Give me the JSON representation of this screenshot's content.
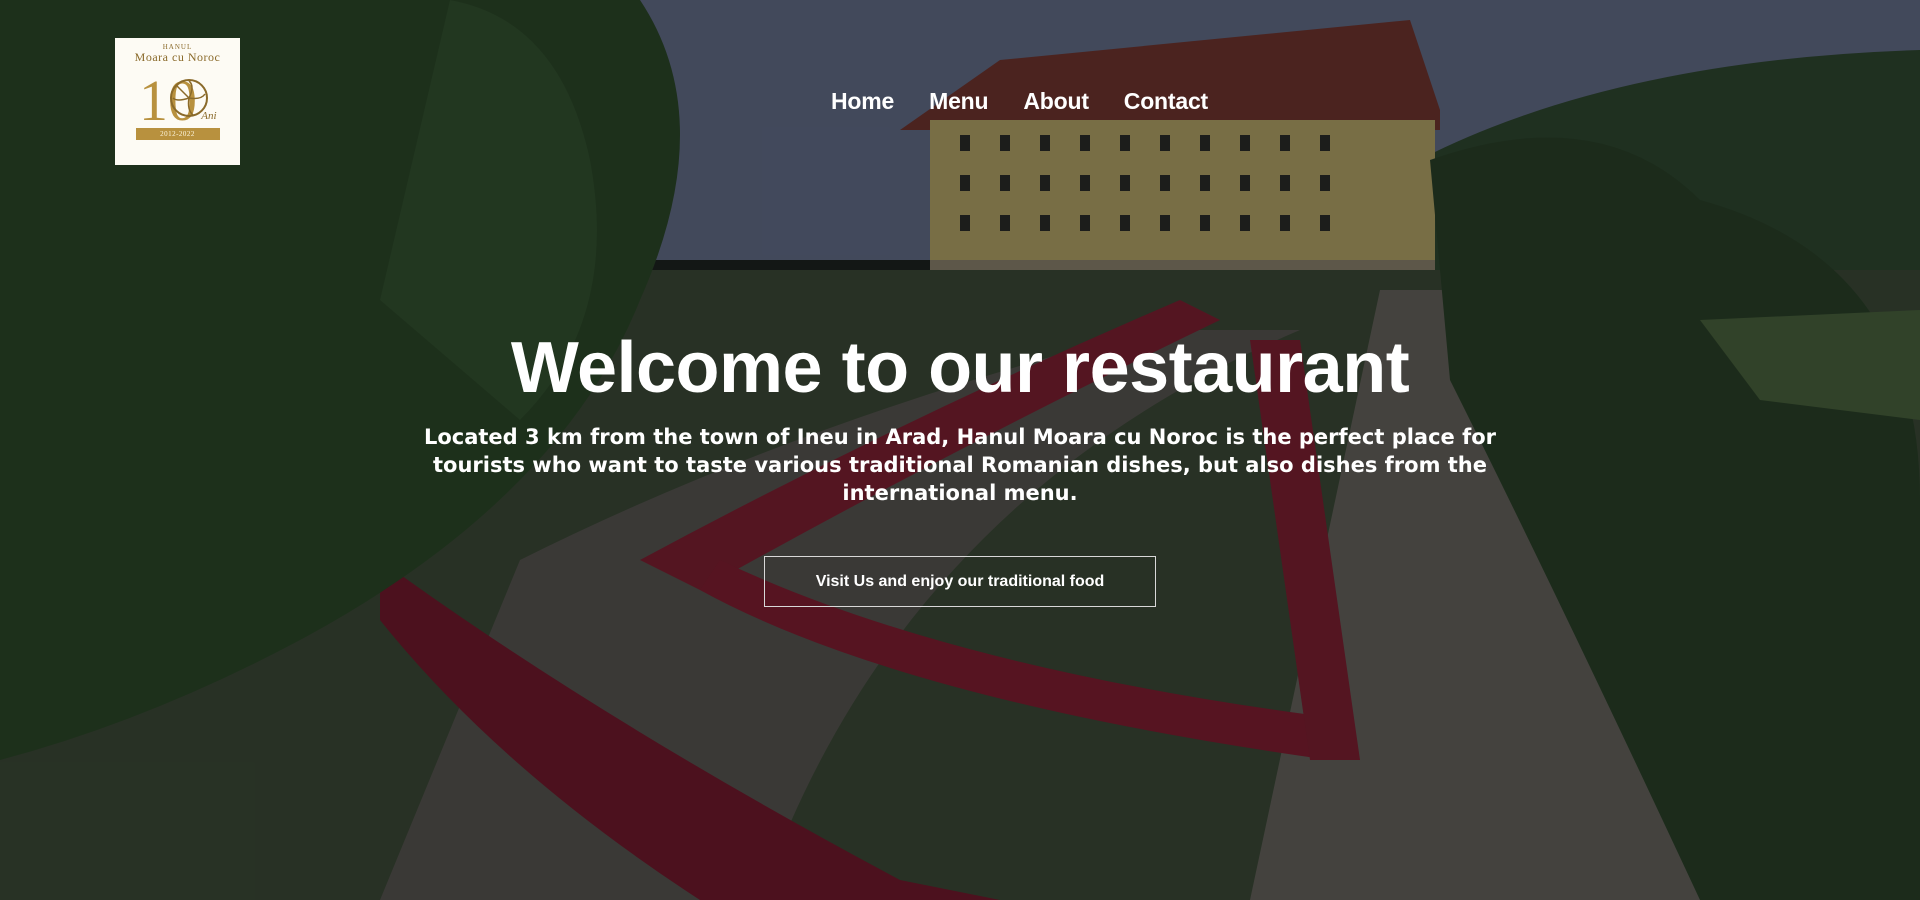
{
  "logo": {
    "top_text": "HANUL",
    "name": "Moara cu Noroc",
    "number": "10",
    "ani": "Ani",
    "years": "2012-2022"
  },
  "nav": {
    "items": [
      {
        "label": "Home"
      },
      {
        "label": "Menu"
      },
      {
        "label": "About"
      },
      {
        "label": "Contact"
      }
    ]
  },
  "hero": {
    "title": "Welcome to our restaurant",
    "description": "Located 3 km from the town of Ineu in Arad, Hanul Moara cu Noroc is the perfect place for tourists who want to taste various traditional Romanian dishes, but also dishes from the international menu.",
    "cta_label": "Visit Us and enjoy our traditional food"
  },
  "colors": {
    "overlay": "#0a0c14",
    "text": "#ffffff",
    "logo_gold": "#b8913e"
  }
}
